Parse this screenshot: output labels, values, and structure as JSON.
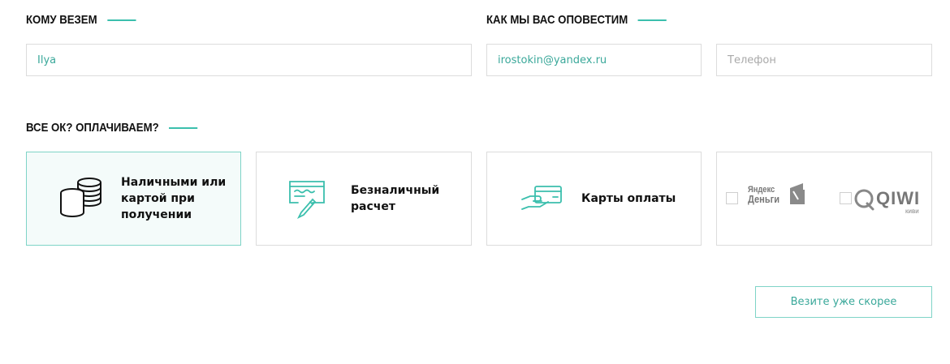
{
  "recipient": {
    "title": "КОМУ ВЕЗЕМ",
    "name_value": "Ilya"
  },
  "notify": {
    "title": "КАК МЫ ВАС ОПОВЕСТИМ",
    "email_value": "irostokin@yandex.ru",
    "phone_placeholder": "Телефон"
  },
  "payment": {
    "title": "ВСЕ ОК? ОПЛАЧИВАЕМ?",
    "options": [
      {
        "label": "Наличными или картой при получении",
        "icon": "coins-icon",
        "selected": true
      },
      {
        "label": "Безналичный расчет",
        "icon": "invoice-pen-icon",
        "selected": false
      },
      {
        "label": "Карты оплаты",
        "icon": "card-in-hand-icon",
        "selected": false
      }
    ],
    "wallets": {
      "yandex_logo": {
        "line1": "Яндекс",
        "line2": "Деньги"
      },
      "qiwi_logo": {
        "word": "QIWI",
        "sub": "киви"
      }
    }
  },
  "submit_label": "Везите уже скорее",
  "colors": {
    "accent": "#3bbfad",
    "accent_text": "#3aa89a",
    "border": "#dcdcdc",
    "selected_bg": "#f4fbfa"
  }
}
